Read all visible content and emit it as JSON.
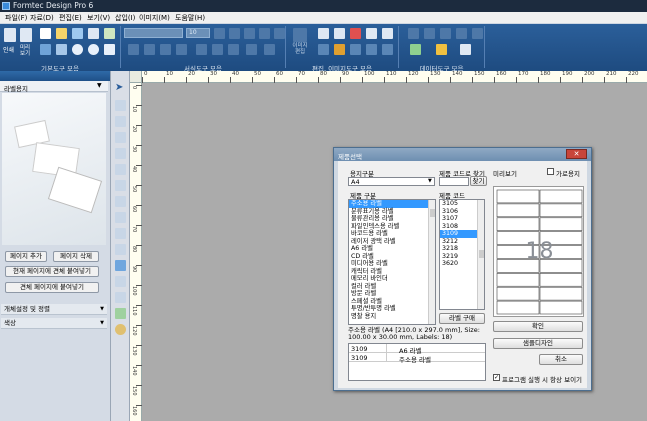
{
  "app": {
    "title": "Formtec Design Pro 6"
  },
  "menu": [
    "파일(F)",
    "자료(D)",
    "편집(E)",
    "보기(V)",
    "삽입(I)",
    "이미지(M)",
    "도움말(H)"
  ],
  "ribbon": {
    "groups": [
      "기본도구 모음",
      "서식도구 모음",
      "편집, 이미지도구 모음",
      "데이터도구 모음"
    ],
    "left_buttons": [
      "인쇄",
      "미리보기"
    ],
    "font_size": "10",
    "edit_button": "이미지\n편집"
  },
  "left_panel": {
    "header": "",
    "dropdown": "라벨용지",
    "buttons": {
      "add_page": "페이지 추가",
      "delete_page": "페이지 삭제",
      "paste_current": "현재 페이지에 견체 붙여넣기",
      "paste_all": "견체 페이지에 붙여넣기"
    },
    "accordions": [
      "개체설정 및 정렬",
      "색상"
    ]
  },
  "ruler": {
    "h_labels": [
      "0",
      "10",
      "20",
      "30",
      "40",
      "50",
      "60",
      "70",
      "80",
      "90",
      "100",
      "110",
      "120",
      "130",
      "140",
      "150",
      "160",
      "170",
      "180",
      "190",
      "200",
      "210",
      "220"
    ],
    "v_labels": [
      "0",
      "10",
      "20",
      "30",
      "40",
      "50",
      "60",
      "70",
      "80",
      "90",
      "100",
      "110",
      "120",
      "130",
      "140",
      "150",
      "160",
      "170"
    ]
  },
  "dialog": {
    "title": "제품선택",
    "paper_label": "용지구분",
    "paper_value": "A4",
    "search_label": "제품 코드로 찾기",
    "find_button": "찾기",
    "preview_label": "미리보기",
    "landscape_label": "가로용지",
    "category_label": "제품 구분",
    "code_label": "제품 코드",
    "categories": [
      "주소용 라벨",
      "분류표기용 라벨",
      "물류관리용 라벨",
      "파일인덱스용 라벨",
      "바코드용 라벨",
      "레이저 광택 라벨",
      "A6 라벨",
      "CD 라벨",
      "미디어용 라벨",
      "캐릭터 라벨",
      "메모리 바인더",
      "컬러 라벨",
      "방문 라벨",
      "스페셜 라벨",
      "투명/반투명 라벨",
      "명찰 용지"
    ],
    "selected_category": 0,
    "codes": [
      "3105",
      "3106",
      "3107",
      "3108",
      "3109",
      "3212",
      "3218",
      "3219",
      "3620"
    ],
    "selected_code": 4,
    "buy_button": "라벨 구매",
    "preview_number": "18",
    "description": "주소용 라벨 (A4 [210.0 x 297.0 mm], Size: 100.00 x 30.00 mm, Labels: 18)",
    "history": [
      {
        "code": "3109",
        "name": "A6 라벨"
      },
      {
        "code": "3109",
        "name": "주소용 라벨"
      }
    ],
    "ok_button": "확인",
    "sample_button": "샘플디자인",
    "cancel_button": "취소",
    "startup_checkbox": "프로그램 실행 시 항상 보이기",
    "startup_checked": true
  }
}
